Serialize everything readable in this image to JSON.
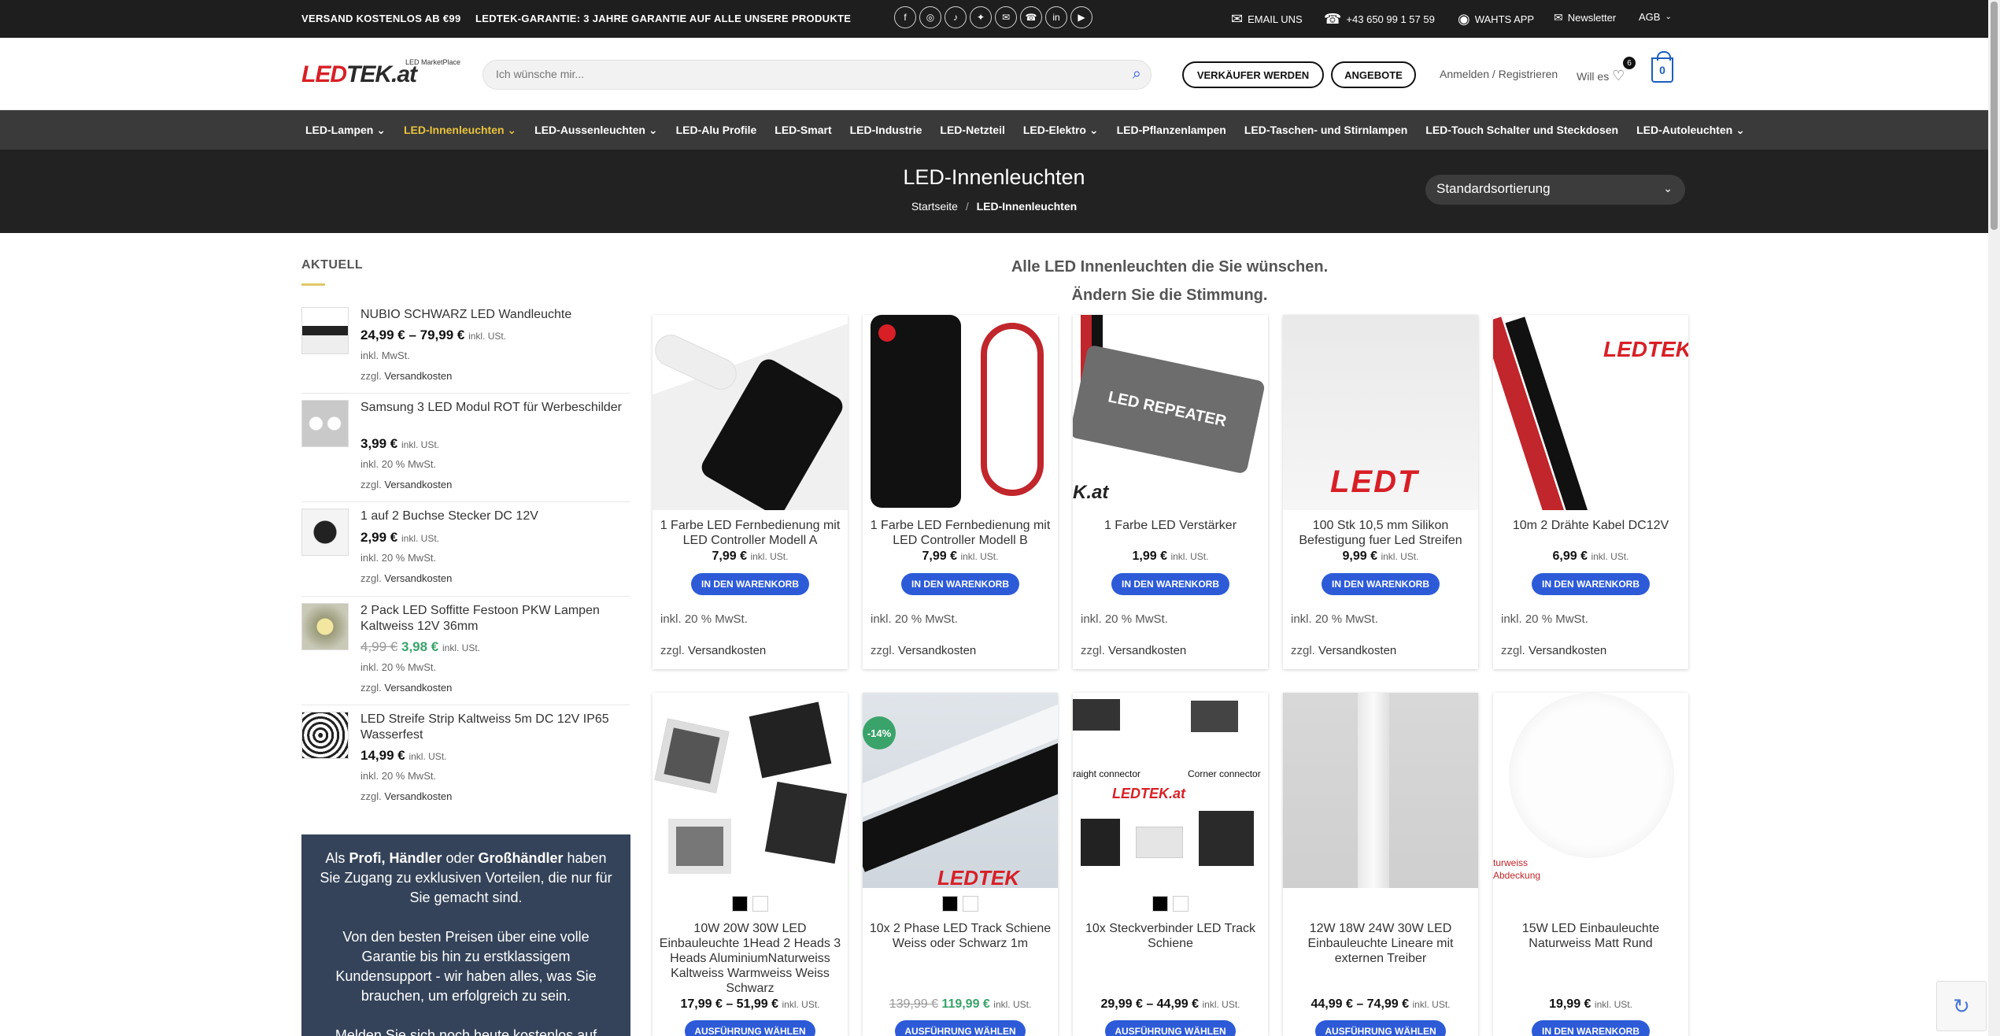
{
  "topbar": {
    "promo1": "VERSAND KOSTENLOS AB €99",
    "promo2": "LEDTEK-GARANTIE: 3 JAHRE GARANTIE AUF ALLE UNSERE PRODUKTE",
    "social_icons": [
      "facebook-icon",
      "instagram-icon",
      "tiktok-icon",
      "twitter-icon",
      "email-icon",
      "phone-icon",
      "linkedin-icon",
      "youtube-icon"
    ],
    "email_label": "EMAIL UNS",
    "phone": "+43 650 99 1 57 59",
    "whatsapp_label": "WAHTS APP",
    "newsletter_label": "Newsletter",
    "agb_label": "AGB"
  },
  "header": {
    "logo_text_a": "LED",
    "logo_text_b": "TEK.at",
    "logo_sub": "LED MarketPlace",
    "search_placeholder": "Ich wünsche mir...",
    "seller_button": "VERKÄUFER WERDEN",
    "offers_button": "ANGEBOTE",
    "login_link": "Anmelden / Registrieren",
    "wishlist_label": "Will es",
    "wishlist_count": "6",
    "cart_count": "0"
  },
  "nav": {
    "items": [
      "LED-Lampen",
      "LED-Innenleuchten",
      "LED-Aussenleuchten",
      "LED-Alu Profile",
      "LED-Smart",
      "LED-Industrie",
      "LED-Netzteil",
      "LED-Elektro",
      "LED-Pflanzenlampen",
      "LED-Taschen- und Stirnlampen",
      "LED-Touch Schalter und Steckdosen",
      "LED-Autoleuchten"
    ]
  },
  "titleband": {
    "title": "LED-Innenleuchten",
    "crumb_home": "Startseite",
    "crumb_sep": "/",
    "crumb_current": "LED-Innenleuchten",
    "sort_selected": "Standardsortierung"
  },
  "sidebar": {
    "title": "AKTUELL",
    "items": [
      {
        "name": "NUBIO SCHWARZ LED Wandleuchte",
        "price": "24,99 € – 79,99 €",
        "tax": "inkl. USt.",
        "line1": "inkl. MwSt.",
        "line2_a": "zzgl.",
        "line2_b": "Versandkosten"
      },
      {
        "name": "Samsung 3 LED Modul ROT für Werbeschilder",
        "price": "3,99 €",
        "tax": "inkl. USt.",
        "line1": "inkl. 20 % MwSt.",
        "line2_a": "zzgl.",
        "line2_b": "Versandkosten"
      },
      {
        "name": "1 auf 2 Buchse Stecker DC 12V",
        "price": "2,99 €",
        "tax": "inkl. USt.",
        "line1": "inkl. 20 % MwSt.",
        "line2_a": "zzgl.",
        "line2_b": "Versandkosten"
      },
      {
        "name": "2 Pack LED Soffitte Festoon PKW Lampen Kaltweiss 12V 36mm",
        "old_price": "4,99 €",
        "price": "3,98 €",
        "tax": "inkl. USt.",
        "line1": "inkl. 20 % MwSt.",
        "line2_a": "zzgl.",
        "line2_b": "Versandkosten"
      },
      {
        "name": "LED Streife Strip Kaltweiss 5m DC 12V IP65 Wasserfest",
        "price": "14,99 €",
        "tax": "inkl. USt.",
        "line1": "inkl. 20 % MwSt.",
        "line2_a": "zzgl.",
        "line2_b": "Versandkosten"
      }
    ],
    "promo": {
      "p1_a": "Als ",
      "p1_b": "Profi, Händler",
      "p1_c": " oder ",
      "p1_d": "Großhändler",
      "p1_e": " haben Sie Zugang zu exklusiven Vorteilen, die nur für Sie gemacht sind.",
      "p2": "Von den besten Preisen über eine volle Garantie bis hin zu erstklassigem Kundensupport - wir haben alles, was Sie brauchen, um erfolgreich zu sein.",
      "p3": "Melden Sie sich noch heute kostenlos auf"
    }
  },
  "main": {
    "intro1": "Alle LED Innenleuchten die Sie wünschen.",
    "intro2": "Ändern Sie die Stimmung.",
    "products": [
      {
        "name": "1 Farbe LED Fernbedienung mit LED Controller Modell A",
        "price": "7,99 €",
        "tax": "inkl. USt.",
        "button": "IN DEN WARENKORB",
        "mwst": "inkl. 20 % MwSt.",
        "vers_a": "zzgl.",
        "vers_b": "Versandkosten"
      },
      {
        "name": "1 Farbe LED Fernbedienung mit LED Controller Modell B",
        "price": "7,99 €",
        "tax": "inkl. USt.",
        "button": "IN DEN WARENKORB",
        "mwst": "inkl. 20 % MwSt.",
        "vers_a": "zzgl.",
        "vers_b": "Versandkosten"
      },
      {
        "name": "1 Farbe LED Verstärker",
        "price": "1,99 €",
        "tax": "inkl. USt.",
        "button": "IN DEN WARENKORB",
        "mwst": "inkl. 20 % MwSt.",
        "vers_a": "zzgl.",
        "vers_b": "Versandkosten",
        "img_text": "LED REPEATER",
        "img_sub": "K.at"
      },
      {
        "name": "100 Stk 10,5 mm Silikon Befestigung fuer Led Streifen",
        "price": "9,99 €",
        "tax": "inkl. USt.",
        "button": "IN DEN WARENKORB",
        "mwst": "inkl. 20 % MwSt.",
        "vers_a": "zzgl.",
        "vers_b": "Versandkosten",
        "img_text": "LEDT"
      },
      {
        "name": "10m 2 Drähte Kabel DC12V",
        "price": "6,99 €",
        "tax": "inkl. USt.",
        "button": "IN DEN WARENKORB",
        "mwst": "inkl. 20 % MwSt.",
        "vers_a": "zzgl.",
        "vers_b": "Versandkosten",
        "img_text": "LEDTEK"
      },
      {
        "name": "10W 20W 30W LED Einbauleuchte 1Head 2 Heads 3 Heads AluminiumNaturweiss Kaltweiss Warmweiss Weiss Schwarz",
        "price": "17,99 € – 51,99 €",
        "tax": "inkl. USt.",
        "button": "AUSFÜHRUNG WÄHLEN"
      },
      {
        "name": "10x 2 Phase LED Track Schiene Weiss oder Schwarz 1m",
        "old_price": "139,99 €",
        "price": "119,99 €",
        "tax": "inkl. USt.",
        "button": "AUSFÜHRUNG WÄHLEN",
        "badge": "-14%",
        "img_text": "LEDTEK"
      },
      {
        "name": "10x Steckverbinder LED Track Schiene",
        "price": "29,99 € – 44,99 €",
        "tax": "inkl. USt.",
        "button": "AUSFÜHRUNG WÄHLEN",
        "img_text_a": "raight connector",
        "img_text_b": "Corner connector",
        "img_text_c": "LEDTEK.at"
      },
      {
        "name": "12W 18W 24W 30W LED Einbauleuchte Lineare mit externen Treiber",
        "price": "44,99 € – 74,99 €",
        "tax": "inkl. USt.",
        "button": "AUSFÜHRUNG WÄHLEN"
      },
      {
        "name": "15W LED Einbauleuchte Naturweiss Matt Rund",
        "price": "19,99 €",
        "tax": "inkl. USt.",
        "button": "IN DEN WARENKORB",
        "img_text": "turweiss Abdeckung"
      }
    ]
  },
  "colors": {
    "accent_blue": "#2d5bd8",
    "nav_active": "#e8c33d",
    "sale_green": "#3aa36a",
    "brand_red": "#d81f26"
  }
}
